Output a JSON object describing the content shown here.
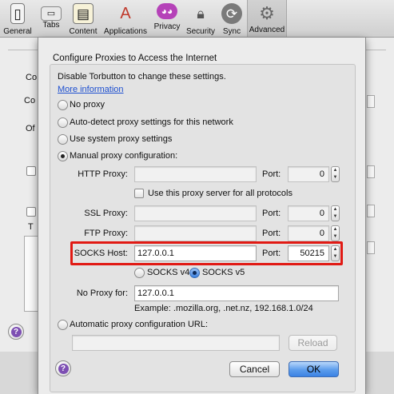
{
  "toolbar": {
    "items": [
      {
        "label": "General",
        "icon": "switch-icon"
      },
      {
        "label": "Tabs",
        "icon": "tabs-icon"
      },
      {
        "label": "Content",
        "icon": "content-icon"
      },
      {
        "label": "Applications",
        "icon": "applications-icon"
      },
      {
        "label": "Privacy",
        "icon": "privacy-mask-icon"
      },
      {
        "label": "Security",
        "icon": "lock-icon"
      },
      {
        "label": "Sync",
        "icon": "sync-icon"
      },
      {
        "label": "Advanced",
        "icon": "gear-icon"
      }
    ],
    "active": "Advanced"
  },
  "background": {
    "frag1": "Co",
    "frag2": "Co",
    "frag3": "Of",
    "frag4": "T"
  },
  "dialog": {
    "title": "Configure Proxies to Access the Internet",
    "notice": "Disable Torbutton to change these settings.",
    "more_info": "More information",
    "options": {
      "no_proxy": "No proxy",
      "auto_detect": "Auto-detect proxy settings for this network",
      "system": "Use system proxy settings",
      "manual": "Manual proxy configuration:",
      "auto_url": "Automatic proxy configuration URL:"
    },
    "selected_option": "manual",
    "http_label": "HTTP Proxy:",
    "http_value": "",
    "http_port": "0",
    "same_proxy_label": "Use this proxy server for all protocols",
    "ssl_label": "SSL Proxy:",
    "ssl_value": "",
    "ssl_port": "0",
    "ftp_label": "FTP Proxy:",
    "ftp_value": "",
    "ftp_port": "0",
    "socks_label": "SOCKS Host:",
    "socks_value": "127.0.0.1",
    "socks_port": "50215",
    "port_label": "Port:",
    "socks_v4": "SOCKS v4",
    "socks_v5": "SOCKS v5",
    "socks_version_selected": "SOCKS v5",
    "no_proxy_label": "No Proxy for:",
    "no_proxy_value": "127.0.0.1",
    "example": "Example: .mozilla.org, .net.nz, 192.168.1.0/24",
    "auto_url_value": "",
    "reload_label": "Reload",
    "cancel_label": "Cancel",
    "ok_label": "OK",
    "help_glyph": "?"
  },
  "colors": {
    "highlight": "#e11a14",
    "link": "#1d4fd0",
    "default_button": "#3b82e4",
    "help": "#7d4fb3"
  }
}
